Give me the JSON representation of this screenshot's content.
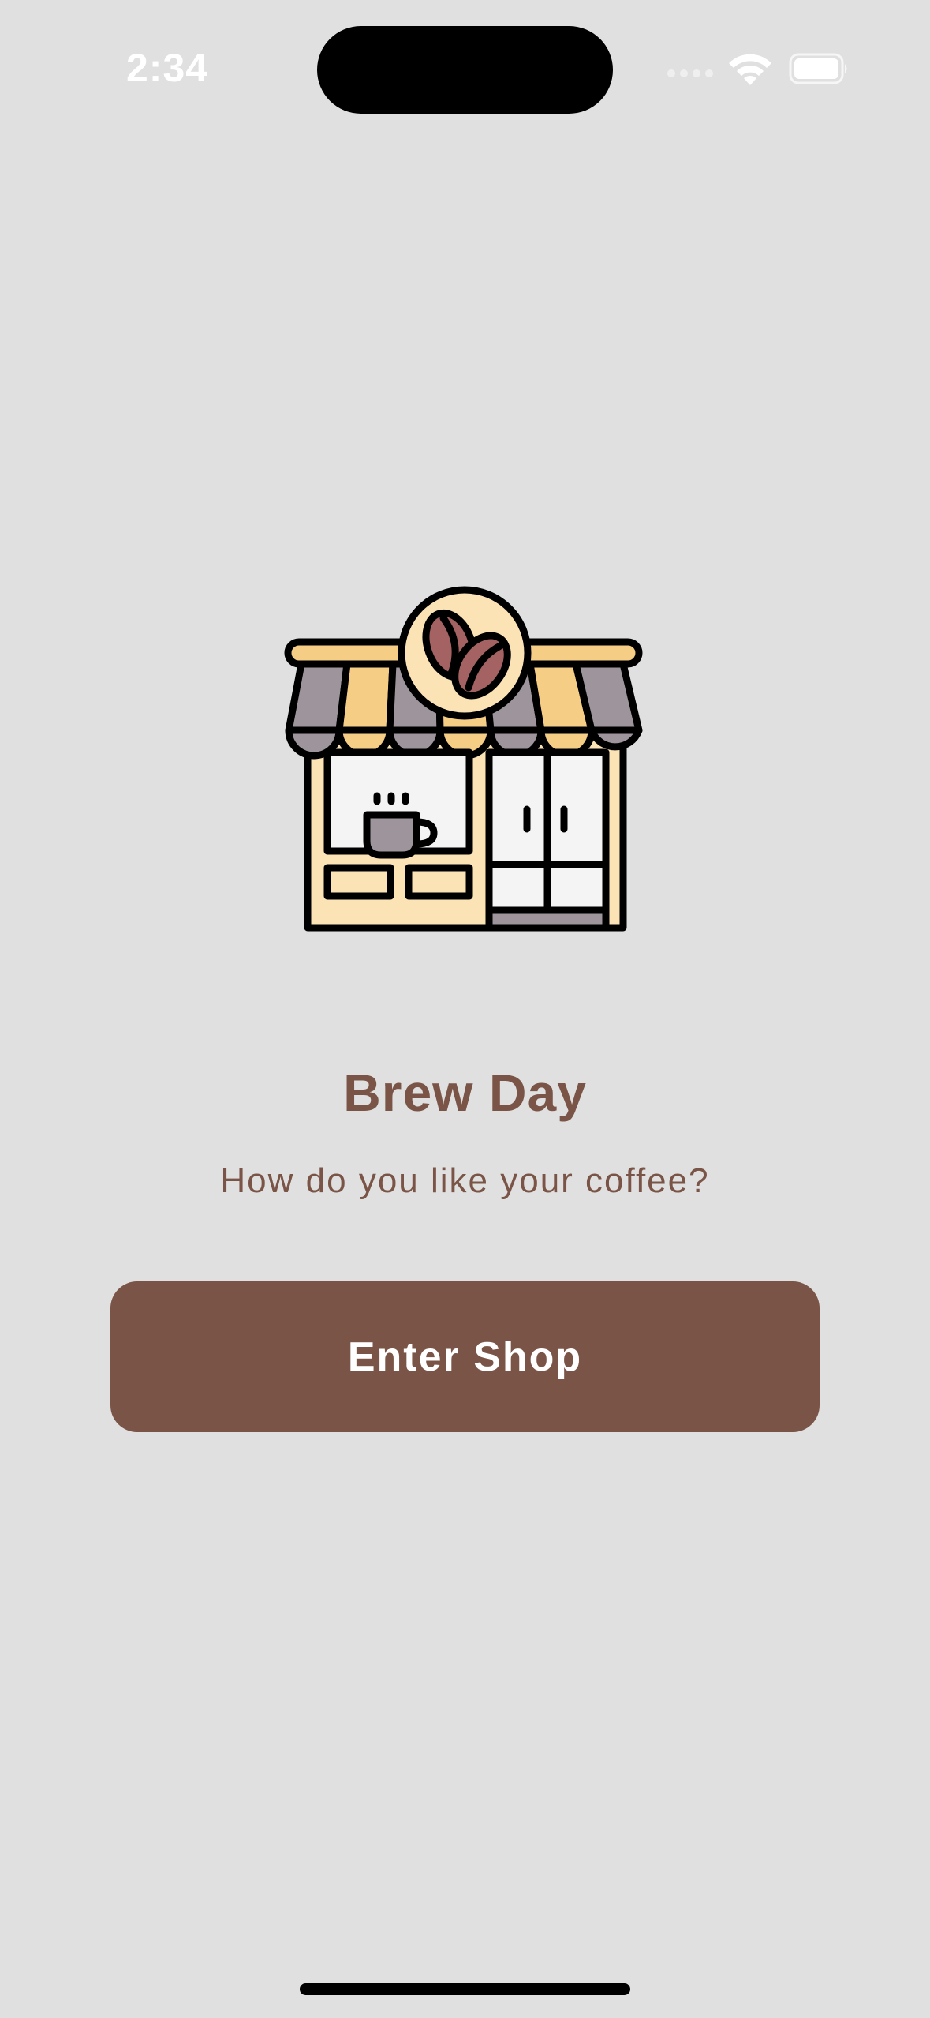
{
  "status_bar": {
    "time": "2:34"
  },
  "illustration": {
    "icon": "coffee-shop-icon"
  },
  "main": {
    "title": "Brew Day",
    "subtitle": "How do you like your coffee?",
    "button_label": "Enter Shop"
  },
  "colors": {
    "background": "#e0e0e0",
    "accent": "#7a5446",
    "awning_yellow": "#f6cd84",
    "awning_gray": "#9d949c",
    "bean": "#a56262",
    "cream": "#fbe3b6"
  }
}
